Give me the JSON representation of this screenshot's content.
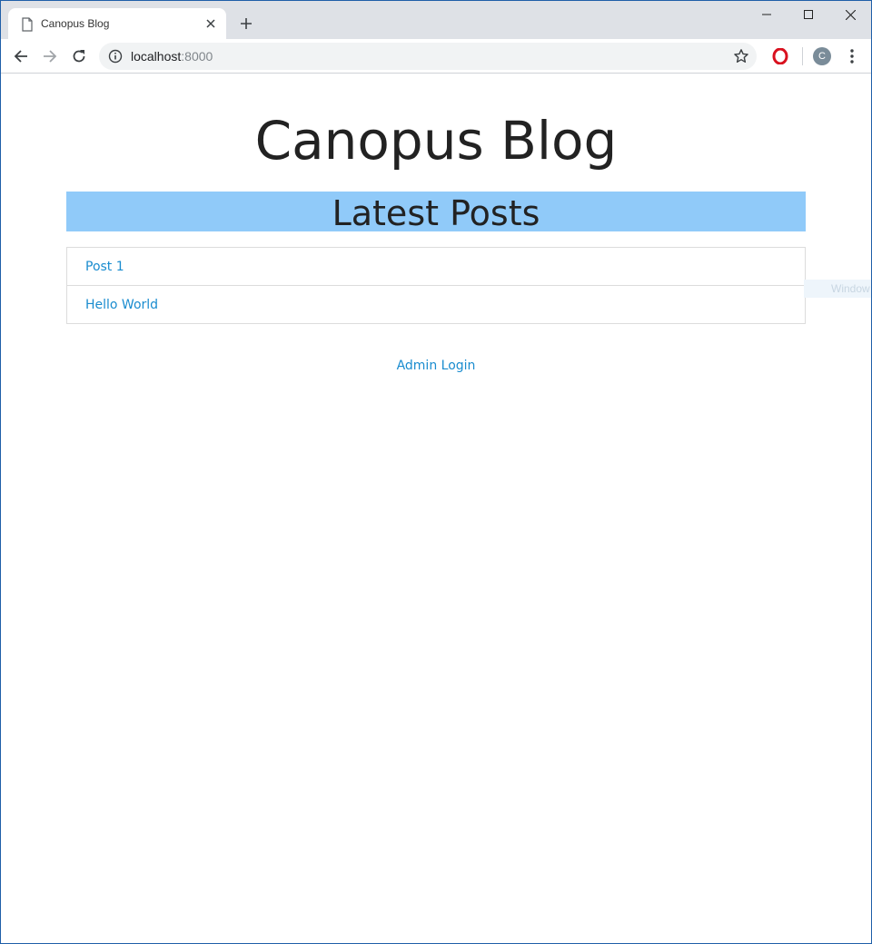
{
  "browser": {
    "tab": {
      "title": "Canopus Blog",
      "favicon": "page-icon"
    },
    "address": {
      "host": "localhost",
      "port": ":8000"
    },
    "profile_initial": "C"
  },
  "site": {
    "title": "Canopus Blog",
    "section_heading": "Latest Posts",
    "posts": [
      {
        "label": "Post 1"
      },
      {
        "label": "Hello World"
      }
    ],
    "admin_link": "Admin Login",
    "accent_color": "#90caf9",
    "link_color": "#1a8ccf"
  },
  "overlay": {
    "text": "Window"
  }
}
